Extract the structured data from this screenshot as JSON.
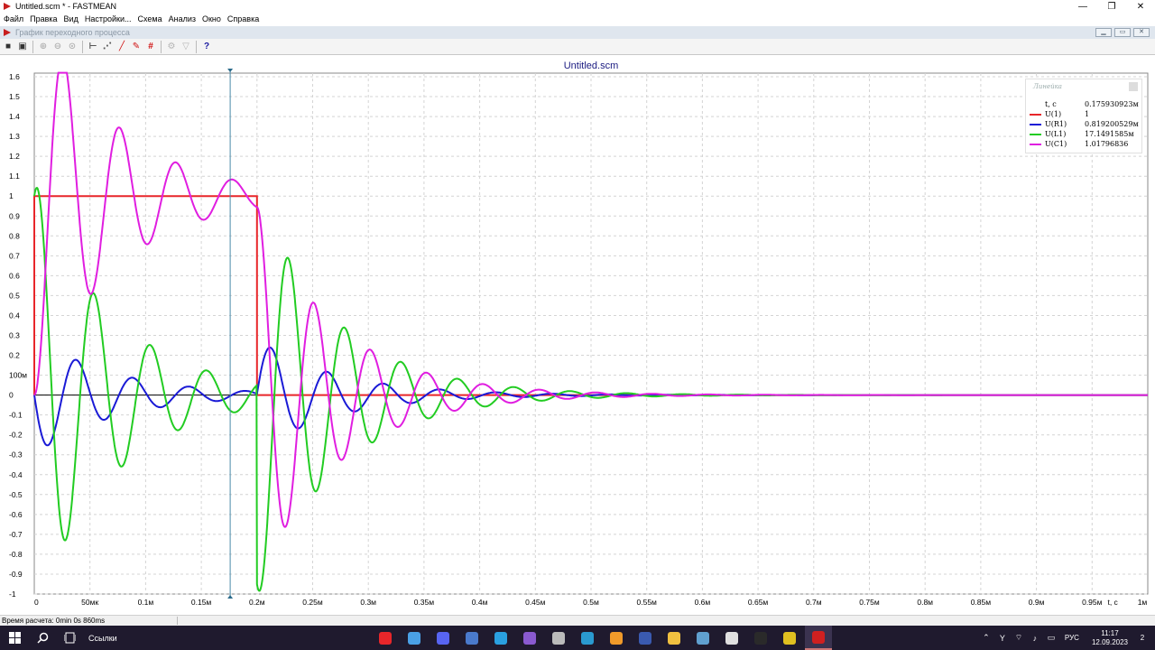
{
  "window": {
    "title": "Untitled.scm * - FASTMEAN",
    "controls": {
      "minimize": "—",
      "restore": "❐",
      "close": "✕"
    }
  },
  "menu": [
    "Файл",
    "Правка",
    "Вид",
    "Настройки...",
    "Схема",
    "Анализ",
    "Окно",
    "Справка"
  ],
  "child_window": {
    "title": "График переходного процесса"
  },
  "toolbar": {
    "buttons": [
      {
        "name": "save-icon",
        "glyph": "■"
      },
      {
        "name": "copy-icon",
        "glyph": "▣"
      },
      {
        "name": "zoom-in-icon",
        "glyph": "⊕"
      },
      {
        "name": "zoom-out-icon",
        "glyph": "⊖"
      },
      {
        "name": "zoom-fit-icon",
        "glyph": "⊙"
      },
      {
        "name": "ruler-icon",
        "glyph": "⊢"
      },
      {
        "name": "points-icon",
        "glyph": "⋰"
      },
      {
        "name": "line-red-icon",
        "glyph": "╱"
      },
      {
        "name": "pen-red-icon",
        "glyph": "✎"
      },
      {
        "name": "grid-red-icon",
        "glyph": "#"
      },
      {
        "name": "settings-icon",
        "glyph": "⚙"
      },
      {
        "name": "filter-icon",
        "glyph": "▽"
      },
      {
        "name": "help-icon",
        "glyph": "?"
      }
    ]
  },
  "chart_data": {
    "type": "line",
    "title": "Untitled.scm",
    "xlabel": "t, c",
    "ylabel": "",
    "xlim": [
      0,
      0.001
    ],
    "ylim": [
      -1,
      1.65
    ],
    "x_ticks": [
      "0",
      "50мк",
      "0.1м",
      "0.15м",
      "0.2м",
      "0.25м",
      "0.3м",
      "0.35м",
      "0.4м",
      "0.45м",
      "0.5м",
      "0.55м",
      "0.6м",
      "0.65м",
      "0.7м",
      "0.75м",
      "0.8м",
      "0.85м",
      "0.9м",
      "0.95м",
      "1м"
    ],
    "y_ticks": [
      "1.6",
      "1.5",
      "1.4",
      "1.3",
      "1.2",
      "1.1",
      "1",
      "0.9",
      "0.8",
      "0.7",
      "0.6",
      "0.5",
      "0.4",
      "0.3",
      "0.2",
      "100м",
      "0",
      "-0.1",
      "-0.2",
      "-0.3",
      "-0.4",
      "-0.5",
      "-0.6",
      "-0.7",
      "-0.8",
      "-0.9",
      "-1"
    ],
    "grid": true,
    "cursor_t": 0.000175930923,
    "series": [
      {
        "name": "U(1)",
        "color": "#e8262a"
      },
      {
        "name": "U(R1)",
        "color": "#1a1ad6"
      },
      {
        "name": "U(L1)",
        "color": "#22cc22"
      },
      {
        "name": "U(C1)",
        "color": "#e01ee0"
      }
    ],
    "circuit": {
      "pulse_end_t": 0.0002,
      "omega_per_s": 124000,
      "decay_per_s": 14000
    }
  },
  "ruler": {
    "header": "Линейка",
    "t_label": "t, c",
    "t_value": "0.175930923м",
    "rows": [
      {
        "name": "U(1)",
        "value": "1",
        "color": "#e8262a"
      },
      {
        "name": "U(R1)",
        "value": "0.819200529м",
        "color": "#1a1ad6"
      },
      {
        "name": "U(L1)",
        "value": "17.1491585м",
        "color": "#22cc22"
      },
      {
        "name": "U(C1)",
        "value": "1.01796836",
        "color": "#e01ee0"
      }
    ]
  },
  "status": {
    "text": "Время расчета: 0min 0s 860ms"
  },
  "taskbar": {
    "search_label": "Ссылки",
    "apps": [
      {
        "name": "yandex-app",
        "color": "#e8262a"
      },
      {
        "name": "files-app",
        "color": "#4aa0e6"
      },
      {
        "name": "discord-app",
        "color": "#5865f2"
      },
      {
        "name": "calculator-app",
        "color": "#4a7acc"
      },
      {
        "name": "telegram-app",
        "color": "#2aa0e0"
      },
      {
        "name": "visualstudio-app",
        "color": "#8a5ad0"
      },
      {
        "name": "printer-app",
        "color": "#bbbbbb"
      },
      {
        "name": "edge-app",
        "color": "#2a9ad0"
      },
      {
        "name": "sublime-app",
        "color": "#f09a2a"
      },
      {
        "name": "save-app",
        "color": "#3a5ab0"
      },
      {
        "name": "explorer-app",
        "color": "#f0c040"
      },
      {
        "name": "notes-app",
        "color": "#60a0d0"
      },
      {
        "name": "word-app",
        "color": "#e0e0e0"
      },
      {
        "name": "pycharm-app",
        "color": "#2a2a2a"
      },
      {
        "name": "git-app",
        "color": "#e0c020"
      },
      {
        "name": "fastmean-app",
        "color": "#d02020"
      }
    ],
    "lang": "РУС",
    "time": "11:17",
    "date": "12.09.2023",
    "notifications": "2"
  }
}
